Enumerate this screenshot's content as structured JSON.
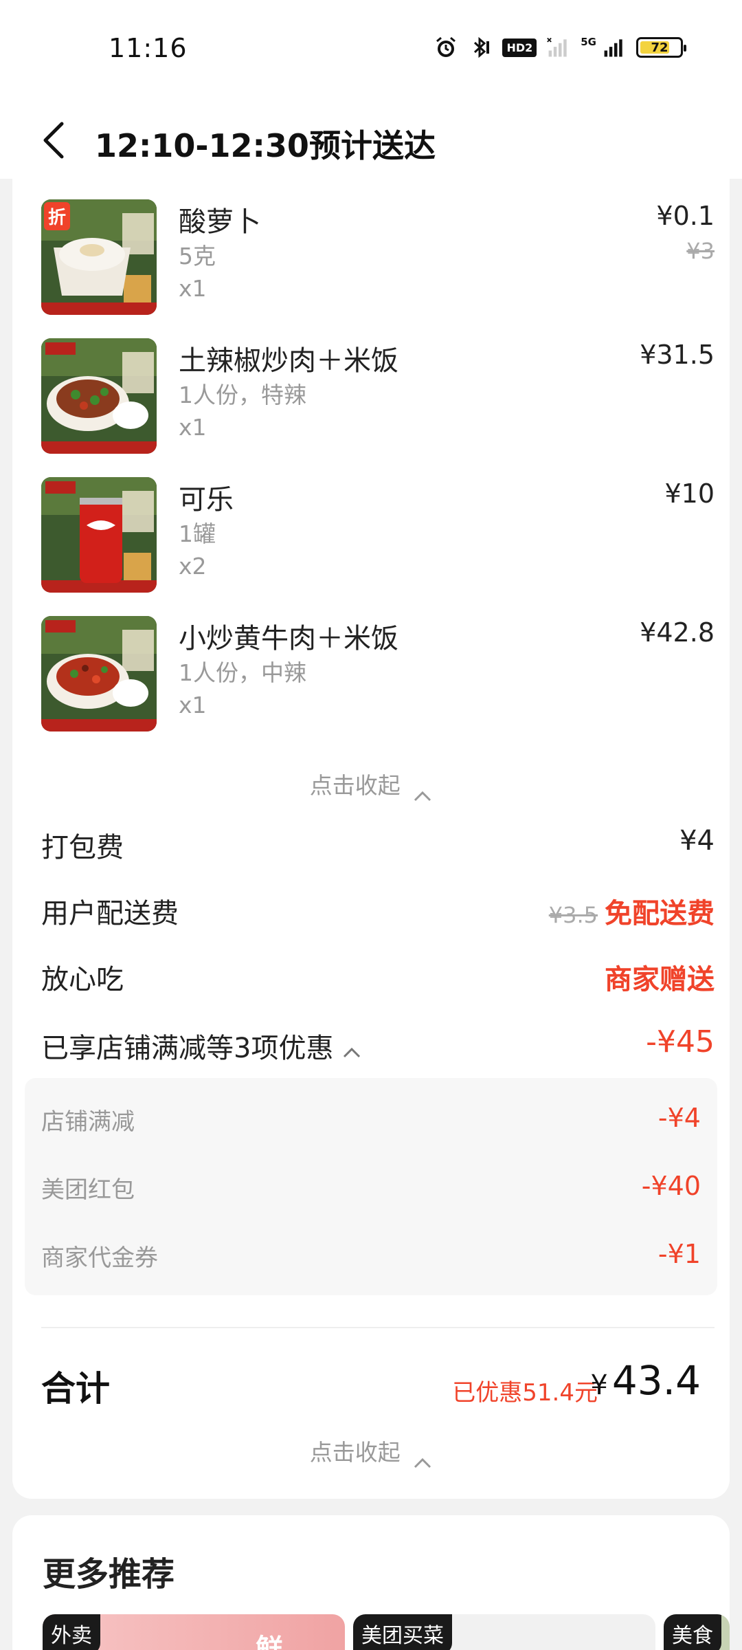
{
  "status_bar": {
    "time": "11:16",
    "hd_label": "HD2",
    "net_label": "5G",
    "battery": "72"
  },
  "header": {
    "title": "12:10-12:30预计送达"
  },
  "items": [
    {
      "name": "酸萝卜",
      "spec": "5克",
      "qty": "x1",
      "price": "¥0.1",
      "orig_price": "¥3",
      "thumb_badge": "折",
      "thumb_type": "radish"
    },
    {
      "name": "土辣椒炒肉＋米饭",
      "spec": "1人份，特辣",
      "qty": "x1",
      "price": "¥31.5",
      "orig_price": "",
      "thumb_badge": "",
      "thumb_type": "pepper-pork"
    },
    {
      "name": "可乐",
      "spec": "1罐",
      "qty": "x2",
      "price": "¥10",
      "orig_price": "",
      "thumb_badge": "",
      "thumb_type": "cola"
    },
    {
      "name": "小炒黄牛肉＋米饭",
      "spec": "1人份，中辣",
      "qty": "x1",
      "price": "¥42.8",
      "orig_price": "",
      "thumb_badge": "",
      "thumb_type": "beef"
    }
  ],
  "collapse_label": "点击收起",
  "fees": {
    "packing_label": "打包费",
    "packing_value": "¥4",
    "delivery_label": "用户配送费",
    "delivery_orig": "¥3.5",
    "delivery_value": "免配送费",
    "assurance_label": "放心吃",
    "assurance_value": "商家赠送",
    "discount_summary_label": "已享店铺满减等3项优惠",
    "discount_summary_value": "-¥45"
  },
  "discounts": [
    {
      "label": "店铺满减",
      "value": "-¥4"
    },
    {
      "label": "美团红包",
      "value": "-¥40"
    },
    {
      "label": "商家代金券",
      "value": "-¥1"
    }
  ],
  "total": {
    "label": "合计",
    "saved": "已优惠51.4元",
    "currency": "¥",
    "amount": "43.4"
  },
  "more": {
    "title": "更多推荐",
    "tags": [
      "外卖",
      "美团买菜",
      "美食"
    ],
    "banner_text": "鲜"
  },
  "colors": {
    "accent_red": "#f0432a",
    "battery_yellow": "#f3d33f"
  }
}
